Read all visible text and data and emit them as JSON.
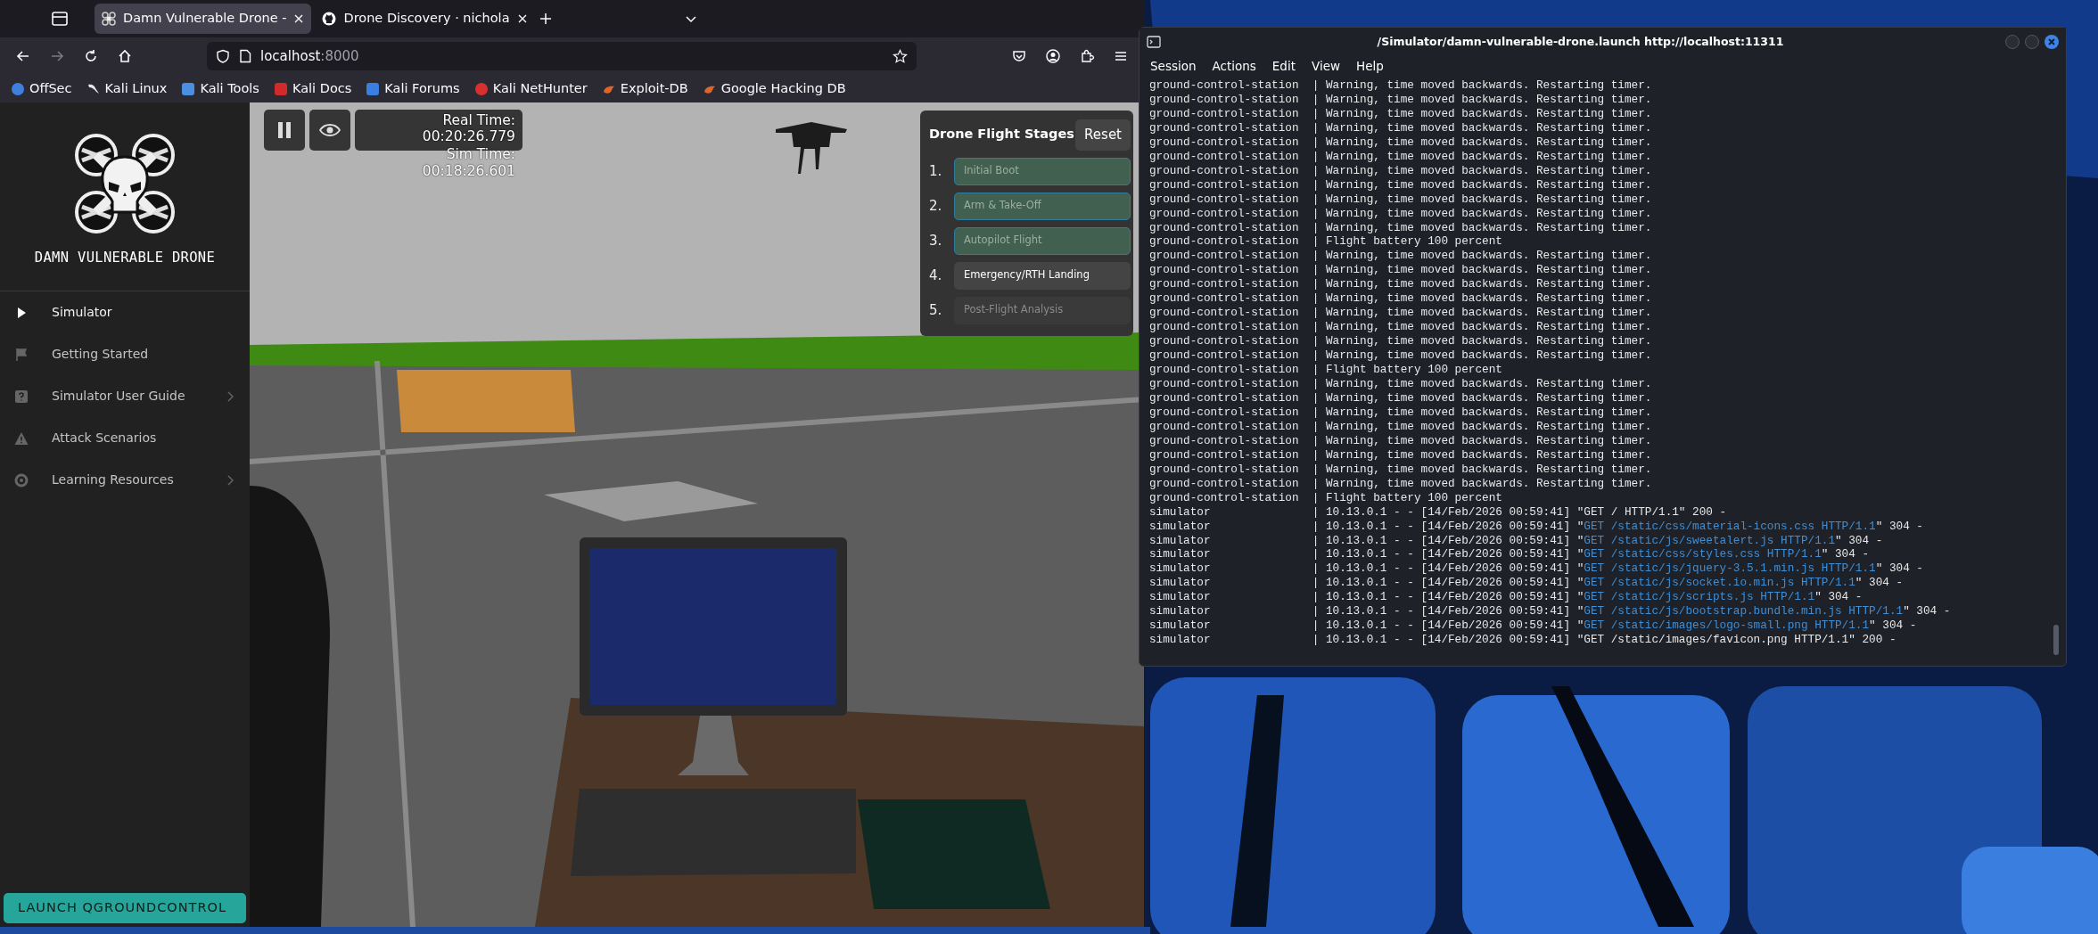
{
  "browser": {
    "tabs": [
      {
        "title": "Damn Vulnerable Drone -",
        "selected": true
      },
      {
        "title": "Drone Discovery · nichola",
        "selected": false
      }
    ],
    "address": {
      "host": "localhost",
      "port": ":8000"
    },
    "bookmarks": [
      {
        "label": "OffSec",
        "color": "#3f7fe0"
      },
      {
        "label": "Kali Linux",
        "color": "#e8e8e8"
      },
      {
        "label": "Kali Tools",
        "color": "#4a8fe0"
      },
      {
        "label": "Kali Docs",
        "color": "#d02a2a"
      },
      {
        "label": "Kali Forums",
        "color": "#3a7ee0"
      },
      {
        "label": "Kali NetHunter",
        "color": "#d83030"
      },
      {
        "label": "Exploit-DB",
        "color": "#e0652a"
      },
      {
        "label": "Google Hacking DB",
        "color": "#e0652a"
      }
    ]
  },
  "sidebar": {
    "brand": "DAMN VULNERABLE DRONE",
    "items": [
      {
        "label": "Simulator",
        "selected": true,
        "submenu": false
      },
      {
        "label": "Getting Started",
        "selected": false,
        "submenu": false
      },
      {
        "label": "Simulator User Guide",
        "selected": false,
        "submenu": true
      },
      {
        "label": "Attack Scenarios",
        "selected": false,
        "submenu": false
      },
      {
        "label": "Learning Resources",
        "selected": false,
        "submenu": true
      }
    ],
    "launch_button": "LAUNCH QGROUNDCONTROL"
  },
  "simulator": {
    "real_time_label": "Real Time:",
    "real_time": "00:20:26.779",
    "sim_time_label": "Sim Time:",
    "sim_time": "00:18:26.601",
    "stages_title": "Drone Flight Stages",
    "reset_button": "Reset",
    "stages": [
      {
        "number": "1.",
        "label": "Initial Boot",
        "kind": "done"
      },
      {
        "number": "2.",
        "label": "Arm & Take-Off",
        "kind": "done"
      },
      {
        "number": "3.",
        "label": "Autopilot Flight",
        "kind": "done"
      },
      {
        "number": "4.",
        "label": "Emergency/RTH Landing",
        "kind": "current"
      },
      {
        "number": "5.",
        "label": "Post-Flight Analysis",
        "kind": "pending"
      }
    ]
  },
  "terminal": {
    "title": "/Simulator/damn-vulnerable-drone.launch http://localhost:11311",
    "menu": [
      "Session",
      "Actions",
      "Edit",
      "View",
      "Help"
    ],
    "lines": [
      {
        "text": "ground-control-station  | Warning, time moved backwards. Restarting timer."
      },
      {
        "text": "ground-control-station  | Warning, time moved backwards. Restarting timer."
      },
      {
        "text": "ground-control-station  | Warning, time moved backwards. Restarting timer."
      },
      {
        "text": "ground-control-station  | Warning, time moved backwards. Restarting timer."
      },
      {
        "text": "ground-control-station  | Warning, time moved backwards. Restarting timer."
      },
      {
        "text": "ground-control-station  | Warning, time moved backwards. Restarting timer."
      },
      {
        "text": "ground-control-station  | Warning, time moved backwards. Restarting timer."
      },
      {
        "text": "ground-control-station  | Warning, time moved backwards. Restarting timer."
      },
      {
        "text": "ground-control-station  | Warning, time moved backwards. Restarting timer."
      },
      {
        "text": "ground-control-station  | Warning, time moved backwards. Restarting timer."
      },
      {
        "text": "ground-control-station  | Warning, time moved backwards. Restarting timer."
      },
      {
        "text": "ground-control-station  | Flight battery 100 percent"
      },
      {
        "text": "ground-control-station  | Warning, time moved backwards. Restarting timer."
      },
      {
        "text": "ground-control-station  | Warning, time moved backwards. Restarting timer."
      },
      {
        "text": "ground-control-station  | Warning, time moved backwards. Restarting timer."
      },
      {
        "text": "ground-control-station  | Warning, time moved backwards. Restarting timer."
      },
      {
        "text": "ground-control-station  | Warning, time moved backwards. Restarting timer."
      },
      {
        "text": "ground-control-station  | Warning, time moved backwards. Restarting timer."
      },
      {
        "text": "ground-control-station  | Warning, time moved backwards. Restarting timer."
      },
      {
        "text": "ground-control-station  | Warning, time moved backwards. Restarting timer."
      },
      {
        "text": "ground-control-station  | Flight battery 100 percent"
      },
      {
        "text": "ground-control-station  | Warning, time moved backwards. Restarting timer."
      },
      {
        "text": "ground-control-station  | Warning, time moved backwards. Restarting timer."
      },
      {
        "text": "ground-control-station  | Warning, time moved backwards. Restarting timer."
      },
      {
        "text": "ground-control-station  | Warning, time moved backwards. Restarting timer."
      },
      {
        "text": "ground-control-station  | Warning, time moved backwards. Restarting timer."
      },
      {
        "text": "ground-control-station  | Warning, time moved backwards. Restarting timer."
      },
      {
        "text": "ground-control-station  | Warning, time moved backwards. Restarting timer."
      },
      {
        "text": "ground-control-station  | Warning, time moved backwards. Restarting timer."
      },
      {
        "text": "ground-control-station  | Flight battery 100 percent"
      },
      {
        "text": "simulator               | 10.13.0.1 - - [14/Feb/2026 00:59:41] \"GET / HTTP/1.1\" 200 -"
      },
      {
        "text": "simulator               | 10.13.0.1 - - [14/Feb/2026 00:59:41] \"",
        "request": "GET /static/css/material-icons.css HTTP/1.1",
        "rest": "\" 304 -"
      },
      {
        "text": "simulator               | 10.13.0.1 - - [14/Feb/2026 00:59:41] \"",
        "request": "GET /static/js/sweetalert.js HTTP/1.1",
        "rest": "\" 304 -"
      },
      {
        "text": "simulator               | 10.13.0.1 - - [14/Feb/2026 00:59:41] \"",
        "request": "GET /static/css/styles.css HTTP/1.1",
        "rest": "\" 304 -"
      },
      {
        "text": "simulator               | 10.13.0.1 - - [14/Feb/2026 00:59:41] \"",
        "request": "GET /static/js/jquery-3.5.1.min.js HTTP/1.1",
        "rest": "\" 304 -"
      },
      {
        "text": "simulator               | 10.13.0.1 - - [14/Feb/2026 00:59:41] \"",
        "request": "GET /static/js/socket.io.min.js HTTP/1.1",
        "rest": "\" 304 -"
      },
      {
        "text": "simulator               | 10.13.0.1 - - [14/Feb/2026 00:59:41] \"",
        "request": "GET /static/js/scripts.js HTTP/1.1",
        "rest": "\" 304 -"
      },
      {
        "text": "simulator               | 10.13.0.1 - - [14/Feb/2026 00:59:41] \"",
        "request": "GET /static/js/bootstrap.bundle.min.js HTTP/1.1",
        "rest": "\" 304 -"
      },
      {
        "text": "simulator               | 10.13.0.1 - - [14/Feb/2026 00:59:41] \"",
        "request": "GET /static/images/logo-small.png HTTP/1.1",
        "rest": "\" 304 -"
      },
      {
        "text": "simulator               | 10.13.0.1 - - [14/Feb/2026 00:59:41] \"GET /static/images/favicon.png HTTP/1.1\" 200 -"
      }
    ]
  }
}
